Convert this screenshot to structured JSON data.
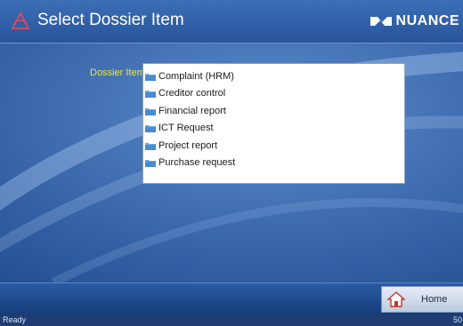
{
  "window": {
    "title": "Select Dossier Item",
    "brand": "NUANCE"
  },
  "form": {
    "label": "Dossier Item:",
    "items": [
      {
        "label": "Complaint (HRM)"
      },
      {
        "label": "Creditor control"
      },
      {
        "label": "Financial report"
      },
      {
        "label": "ICT Request"
      },
      {
        "label": "Project report"
      },
      {
        "label": "Purchase request"
      }
    ]
  },
  "footer": {
    "home_label": "Home"
  },
  "status": {
    "left": "Ready",
    "right": "50"
  },
  "colors": {
    "accent_label": "#f2e63a",
    "background": "#3f6db0",
    "folder": "#6aa6e0"
  },
  "icons": {
    "title": "app-logo-icon",
    "brand": "nuance-logo-icon",
    "item": "folder-icon",
    "home": "home-icon"
  }
}
